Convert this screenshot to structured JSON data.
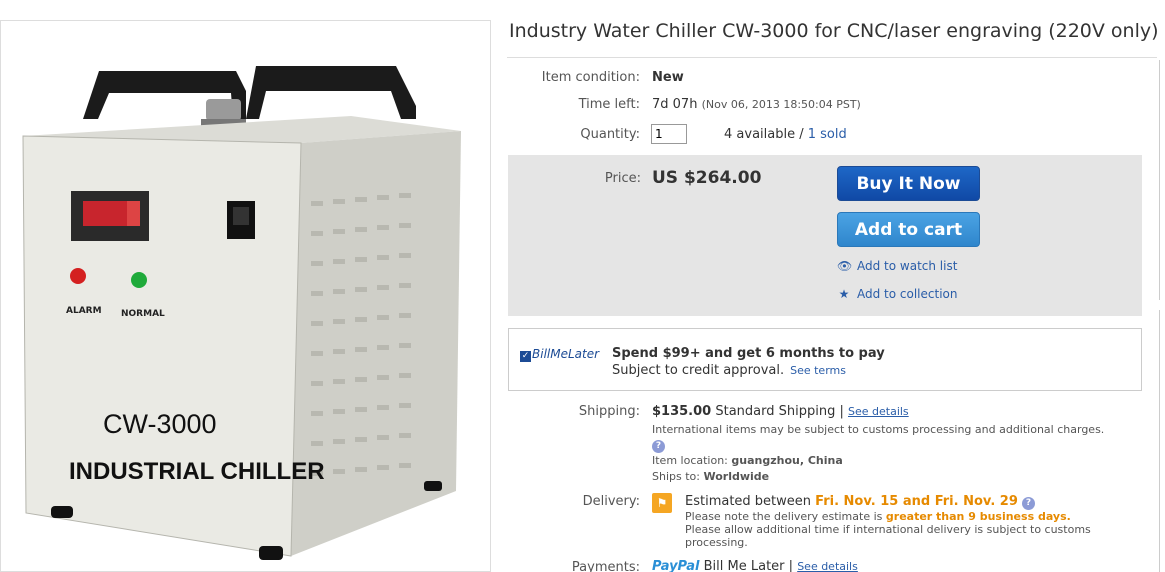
{
  "product": {
    "title": "Industry Water Chiller CW-3000 for CNC/laser engraving (220V only)",
    "image_texts": {
      "model": "CW-3000",
      "name": "INDUSTRIAL CHILLER",
      "alarm": "ALARM",
      "normal": "NORMAL"
    }
  },
  "condition": {
    "label": "Item condition:",
    "value": "New"
  },
  "time_left": {
    "label": "Time left:",
    "value": "7d 07h",
    "end": "(Nov 06, 2013  18:50:04 PST)"
  },
  "quantity": {
    "label": "Quantity:",
    "value": "1",
    "available": "4 available",
    "sep": " / ",
    "sold": "1 sold"
  },
  "price": {
    "label": "Price:",
    "value": "US $264.00"
  },
  "actions": {
    "buy_now": "Buy It Now",
    "add_to_cart": "Add to cart",
    "watch": "Add to watch list",
    "collection": "Add to collection"
  },
  "bill_me_later": {
    "logo": "BillMeLater",
    "headline": "Spend $99+ and get 6 months to pay",
    "sub": "Subject to credit approval.",
    "link": "See terms"
  },
  "shipping": {
    "label": "Shipping:",
    "cost": "$135.00",
    "method": "Standard Shipping",
    "sep": " | ",
    "details_link": "See details",
    "intl_note": "International items may be subject to customs processing and additional charges.",
    "location_label": "Item location:",
    "location": "guangzhou, China",
    "ships_label": "Ships to:",
    "ships_to": "Worldwide"
  },
  "delivery": {
    "label": "Delivery:",
    "est_prefix": "Estimated between",
    "range": "Fri. Nov. 15 and Fri. Nov. 29",
    "note1_prefix": "Please note the delivery estimate is",
    "note1_emph": "greater than 9 business days.",
    "note2": "Please allow additional time if international delivery is subject to customs processing."
  },
  "payments": {
    "label": "Payments:",
    "paypal_a": "Pay",
    "paypal_b": "Pal",
    "method": "Bill Me Later",
    "sep": "|",
    "details_link": "See details"
  },
  "colors": {
    "link": "#2a5da8",
    "buy_button": "#1049a6",
    "cart_button": "#2f86cc",
    "accent_orange": "#e68a00",
    "price_box": "#e5e5e5"
  }
}
